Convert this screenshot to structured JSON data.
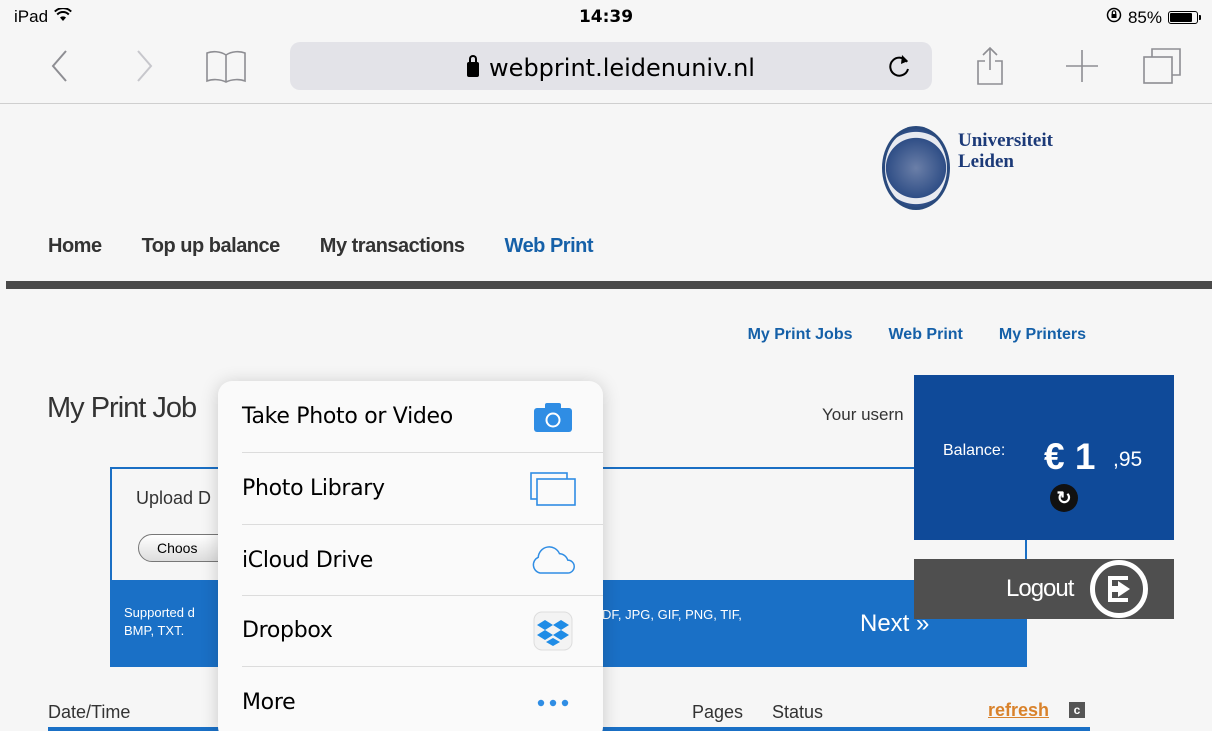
{
  "status_bar": {
    "device": "iPad",
    "time": "14:39",
    "battery": "85%",
    "battery_level": 0.85
  },
  "browser": {
    "url": "webprint.leidenuniv.nl"
  },
  "logo": {
    "line1": "Universiteit",
    "line2": "Leiden"
  },
  "main_nav": {
    "items": [
      {
        "label": "Home"
      },
      {
        "label": "Top up balance"
      },
      {
        "label": "My transactions"
      },
      {
        "label": "Web Print"
      }
    ]
  },
  "sub_nav": {
    "items": [
      {
        "label": "My Print Jobs"
      },
      {
        "label": "Web Print"
      },
      {
        "label": "My Printers"
      }
    ]
  },
  "page": {
    "title": "My Print Job",
    "username_label": "Your usern",
    "upload_label": "Upload D",
    "choose_button": "Choos",
    "supported_text": "Supported d BMP, TXT.",
    "supported_formats": "DF, JPG, GIF, PNG, TIF,",
    "next_button": "Next »"
  },
  "balance": {
    "label": "Balance:",
    "euro": "€ 1",
    "cents": ",95"
  },
  "logout": {
    "label": "Logout"
  },
  "table": {
    "columns": {
      "datetime": "Date/Time",
      "pages": "Pages",
      "status": "Status"
    },
    "refresh_link": "refresh"
  },
  "popover": {
    "items": [
      {
        "label": "Take Photo or Video",
        "icon": "camera-icon"
      },
      {
        "label": "Photo Library",
        "icon": "photo-library-icon"
      },
      {
        "label": "iCloud Drive",
        "icon": "icloud-icon"
      },
      {
        "label": "Dropbox",
        "icon": "dropbox-icon"
      },
      {
        "label": "More",
        "icon": "more-icon"
      }
    ]
  }
}
